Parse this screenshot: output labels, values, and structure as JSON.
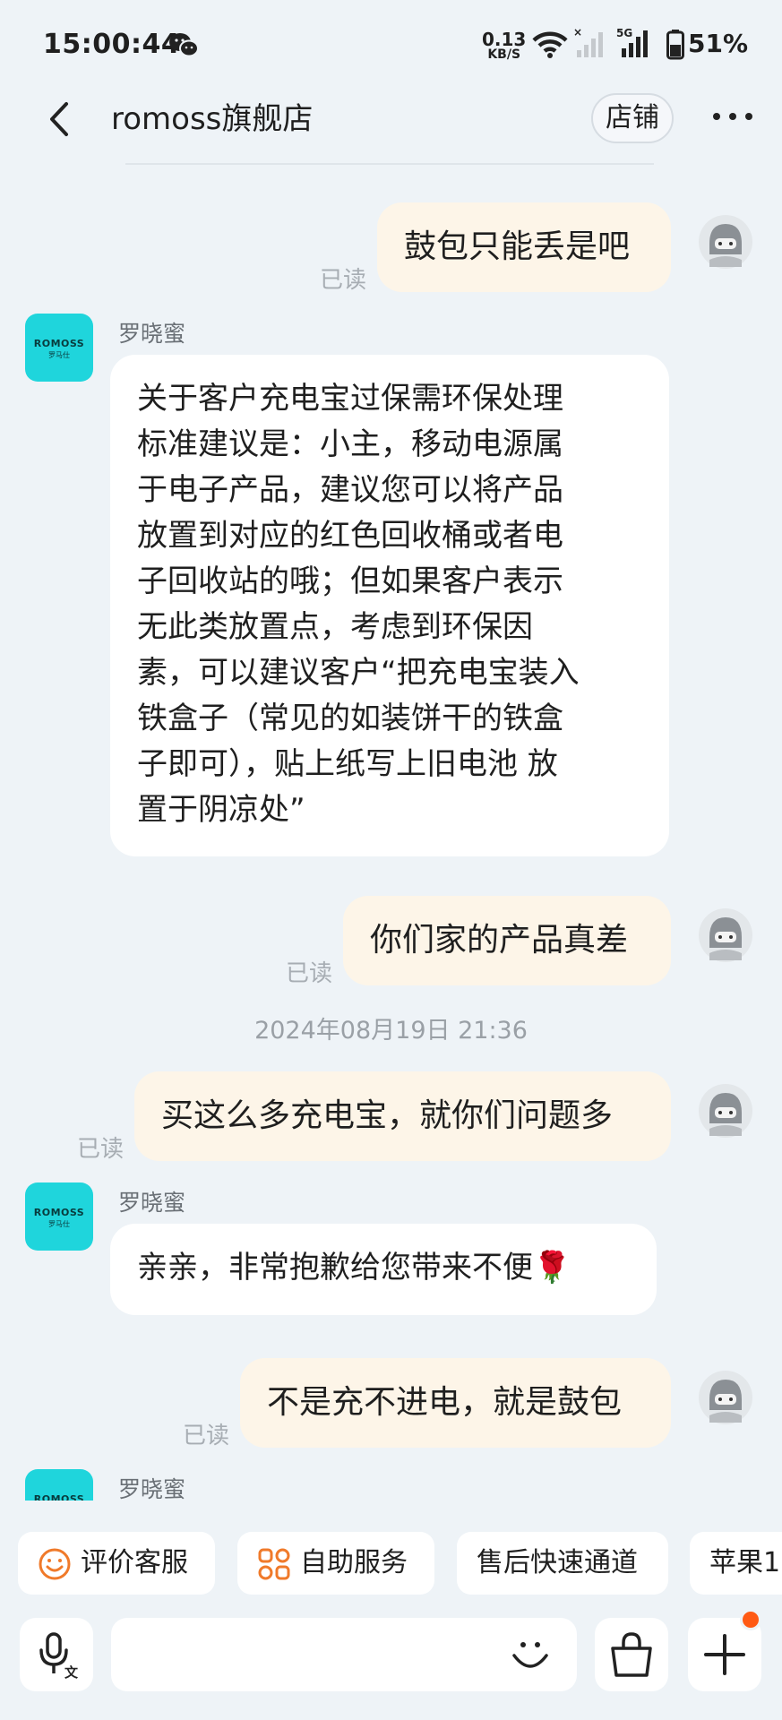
{
  "status_bar": {
    "time": "15:00:44",
    "net_speed_value": "0.13",
    "net_speed_unit": "KB/S",
    "network": "5G",
    "battery": "51%"
  },
  "header": {
    "title": "romoss旗舰店",
    "store_button": "店铺"
  },
  "shop_avatar": {
    "brand": "ROMOSS",
    "sub": "罗马仕"
  },
  "messages": [
    {
      "from": "me",
      "text": "鼓包只能丢是吧",
      "status": "已读"
    },
    {
      "from": "shop",
      "sender": "罗晓蜜",
      "lines": [
        "关于客户充电宝过保需环保处理",
        "标准建议是：小主，移动电源属",
        "于电子产品，建议您可以将产品",
        "放置到对应的红色回收桶或者电",
        "子回收站的哦；但如果客户表示",
        "无此类放置点，考虑到环保因",
        "素，可以建议客户“把充电宝装入",
        "铁盒子（常见的如装饼干的铁盒",
        "子即可），贴上纸写上旧电池 放",
        "置于阴凉处”"
      ]
    },
    {
      "from": "me",
      "text": "你们家的产品真差",
      "status": "已读"
    },
    {
      "from": "system",
      "text": "2024年08月19日 21:36"
    },
    {
      "from": "me",
      "text": "买这么多充电宝，就你们问题多",
      "status": "已读"
    },
    {
      "from": "shop",
      "sender": "罗晓蜜",
      "text": "亲亲，非常抱歉给您带来不便🌹"
    },
    {
      "from": "me",
      "text": "不是充不进电，就是鼓包",
      "status": "已读"
    },
    {
      "from": "shop",
      "sender": "罗晓蜜"
    }
  ],
  "quick_actions": [
    {
      "label": "评价客服",
      "icon": "smile-icon"
    },
    {
      "label": "自助服务",
      "icon": "grid-icon"
    },
    {
      "label": "售后快速通道"
    },
    {
      "label": "苹果1"
    }
  ],
  "input_bar": {
    "voice_icon": "voice-translate-icon",
    "emoji_icon": "emoji-icon",
    "bag_icon": "shopping-bag-icon",
    "plus_icon": "plus-icon"
  },
  "colors": {
    "background": "#eef3f7",
    "my_bubble": "#fdf5e8",
    "shop_bubble": "#ffffff",
    "accent_orange": "#f07a2a",
    "brand_cyan": "#1fd5dc",
    "notification_dot": "#ff5a14"
  }
}
